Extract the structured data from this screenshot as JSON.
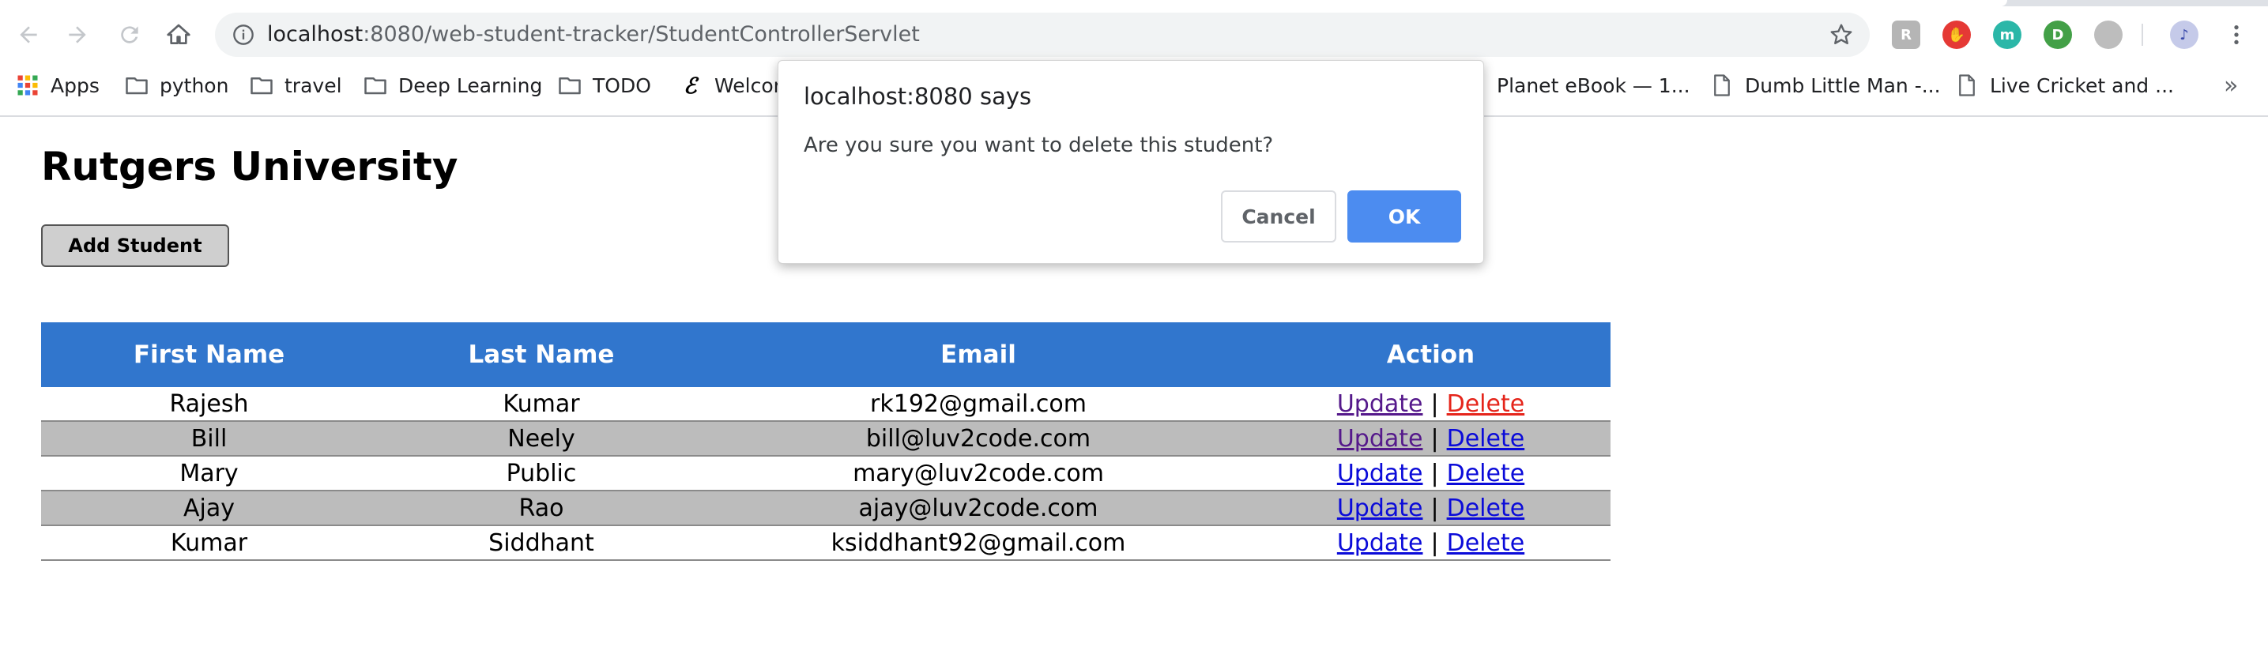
{
  "browser": {
    "url_host": "localhost",
    "url_rest": ":8080/web-student-tracker/StudentControllerServlet",
    "bookmarks": [
      {
        "label": "Apps",
        "icon": "apps-grid-icon"
      },
      {
        "label": "python",
        "icon": "folder-icon"
      },
      {
        "label": "travel",
        "icon": "folder-icon"
      },
      {
        "label": "Deep Learning",
        "icon": "folder-icon"
      },
      {
        "label": "TODO",
        "icon": "folder-icon"
      },
      {
        "label": "Welcor",
        "icon": "evernote-icon"
      },
      {
        "label": "Planet eBook — 1...",
        "icon": "bookmark-icon"
      },
      {
        "label": "Dumb Little Man -...",
        "icon": "page-icon"
      },
      {
        "label": "Live Cricket and ...",
        "icon": "page-icon"
      }
    ],
    "overflow_label": "»"
  },
  "page": {
    "title": "Rutgers University",
    "add_button_label": "Add Student",
    "table": {
      "headers": [
        "First Name",
        "Last Name",
        "Email",
        "Action"
      ],
      "rows": [
        {
          "first": "Rajesh",
          "last": "Kumar",
          "email": "rk192@gmail.com"
        },
        {
          "first": "Bill",
          "last": "Neely",
          "email": "bill@luv2code.com"
        },
        {
          "first": "Mary",
          "last": "Public",
          "email": "mary@luv2code.com"
        },
        {
          "first": "Ajay",
          "last": "Rao",
          "email": "ajay@luv2code.com"
        },
        {
          "first": "Kumar",
          "last": "Siddhant",
          "email": "ksiddhant92@gmail.com"
        }
      ],
      "update_label": "Update",
      "delete_label": "Delete",
      "separator": "|"
    }
  },
  "dialog": {
    "title": "localhost:8080 says",
    "message": "Are you sure you want to delete this student?",
    "cancel_label": "Cancel",
    "ok_label": "OK"
  },
  "colors": {
    "header_blue": "#3176cd",
    "alt_row_gray": "#bcbcbc",
    "ok_button_blue": "#4c8cf0",
    "link_blue": "#0b0bd9",
    "link_visited": "#55198b",
    "link_active_red": "#e5251b"
  }
}
